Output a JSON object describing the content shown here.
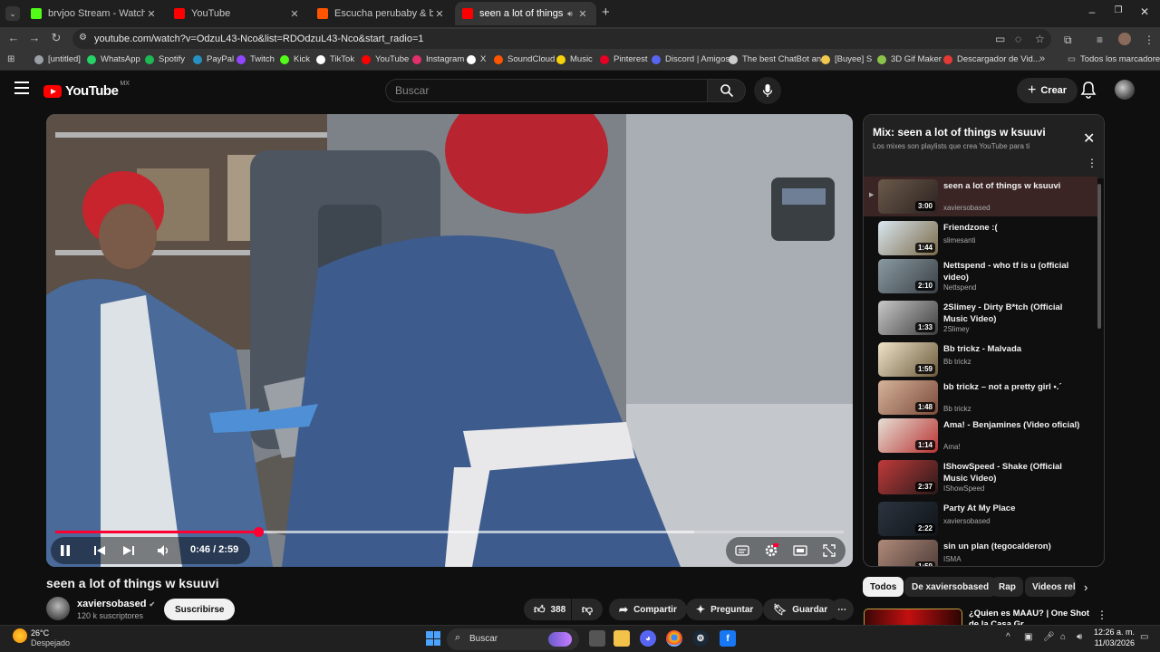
{
  "browser": {
    "tabs": [
      {
        "title": "brvjoo Stream - Watch Live on K",
        "favicon": "kick-icon",
        "color": "#53fc18"
      },
      {
        "title": "YouTube",
        "favicon": "youtube-icon",
        "color": "#ff0000"
      },
      {
        "title": "Escucha perubaby & boolymon",
        "favicon": "soundcloud-icon",
        "color": "#ff5500"
      },
      {
        "title": "seen a lot of things w ksuu",
        "favicon": "youtube-icon",
        "color": "#ff0000",
        "active": true
      }
    ],
    "url": "youtube.com/watch?v=OdzuL43-Nco&list=RDOdzuL43-Nco&start_radio=1",
    "bookmarks": [
      {
        "label": "[untitled]",
        "color": "#9aa0a6"
      },
      {
        "label": "WhatsApp",
        "color": "#25d366"
      },
      {
        "label": "Spotify",
        "color": "#1db954"
      },
      {
        "label": "PayPal",
        "color": "#2790c3"
      },
      {
        "label": "Twitch",
        "color": "#9146ff"
      },
      {
        "label": "Kick",
        "color": "#53fc18"
      },
      {
        "label": "TikTok",
        "color": "#ffffff"
      },
      {
        "label": "YouTube",
        "color": "#ff0000"
      },
      {
        "label": "Instagram",
        "color": "#e1306c"
      },
      {
        "label": "X",
        "color": "#ffffff"
      },
      {
        "label": "SoundCloud",
        "color": "#ff5500"
      },
      {
        "label": "Music",
        "color": "#f5d20b"
      },
      {
        "label": "Pinterest",
        "color": "#e60023"
      },
      {
        "label": "Discord | Amigos",
        "color": "#5865f2"
      },
      {
        "label": "The best ChatBot an...",
        "color": "#cccccc"
      },
      {
        "label": "[Buyee] S",
        "color": "#f2c94c"
      },
      {
        "label": "3D Gif Maker",
        "color": "#8bc34a"
      },
      {
        "label": "Descargador de Vid...",
        "color": "#e53935"
      }
    ],
    "bookmarks_all": "Todos los marcadores"
  },
  "header": {
    "logo_word": "YouTube",
    "logo_country": "MX",
    "search_placeholder": "Buscar",
    "create_label": "Crear"
  },
  "player": {
    "time_current": "0:46",
    "time_total": "2:59",
    "time_label": "0:46 / 2:59",
    "progress_fraction": 0.257,
    "buffer_fraction": 0.81
  },
  "video": {
    "title": "seen a lot of things w ksuuvi",
    "channel": "xaviersobased",
    "verified_mark": "✔",
    "subscribers": "120 k suscriptores",
    "subscribe_label": "Suscribirse",
    "likes": "388",
    "share_label": "Compartir",
    "ask_label": "Preguntar",
    "save_label": "Guardar"
  },
  "playlist": {
    "title": "Mix: seen a lot of things w ksuuvi",
    "subtitle": "Los mixes son playlists que crea YouTube para ti",
    "items": [
      {
        "title": "seen a lot of things w ksuuvi",
        "channel": "xaviersobased",
        "duration": "3:00",
        "current": true,
        "thumb": [
          "#6b5a4a",
          "#2b2220"
        ]
      },
      {
        "title": "Friendzone :(",
        "channel": "slimesanti",
        "duration": "1:44",
        "thumb": [
          "#d9e6f0",
          "#7a6a48"
        ]
      },
      {
        "title": "Nettspend - who tf is u (official video)",
        "channel": "Nettspend",
        "duration": "2:10",
        "thumb": [
          "#8a9aa2",
          "#3a4045"
        ]
      },
      {
        "title": "2Slimey - Dirty B*tch (Official Music Video)",
        "channel": "2Slimey",
        "duration": "1:33",
        "thumb": [
          "#c8c8c8",
          "#3d3d3d"
        ]
      },
      {
        "title": "Bb trickz - Malvada",
        "channel": "Bb trickz",
        "duration": "1:59",
        "thumb": [
          "#efe3c9",
          "#6a5a3a"
        ]
      },
      {
        "title": "bb trickz – not a pretty girl •.´",
        "channel": "Bb trickz",
        "duration": "1:48",
        "thumb": [
          "#d6b39a",
          "#7b4a3a"
        ]
      },
      {
        "title": "Ama! - Benjamines (Video oficial)",
        "channel": "Ama!",
        "duration": "1:14",
        "thumb": [
          "#e6dfd4",
          "#b83232"
        ]
      },
      {
        "title": "IShowSpeed - Shake (Official Music Video)",
        "channel": "IShowSpeed",
        "duration": "2:37",
        "thumb": [
          "#c03a3a",
          "#2a1a1a"
        ]
      },
      {
        "title": "Party At My Place",
        "channel": "xaviersobased",
        "duration": "2:22",
        "thumb": [
          "#2c3440",
          "#101418"
        ]
      },
      {
        "title": "sin un plan (tegocalderon)",
        "channel": "ISMA",
        "duration": "1:59",
        "thumb": [
          "#b08a7a",
          "#4a3a36"
        ]
      }
    ]
  },
  "chips": [
    "Todos",
    "De xaviersobased",
    "Rap",
    "Videos rela"
  ],
  "recommendation": {
    "title": "¿Quien es MAAU? | One Shot de la Casa Gr..."
  },
  "taskbar": {
    "temperature": "26°C",
    "weather": "Despejado",
    "search_label": "Buscar",
    "time": "12:26 a. m.",
    "date": "11/03/2026"
  }
}
